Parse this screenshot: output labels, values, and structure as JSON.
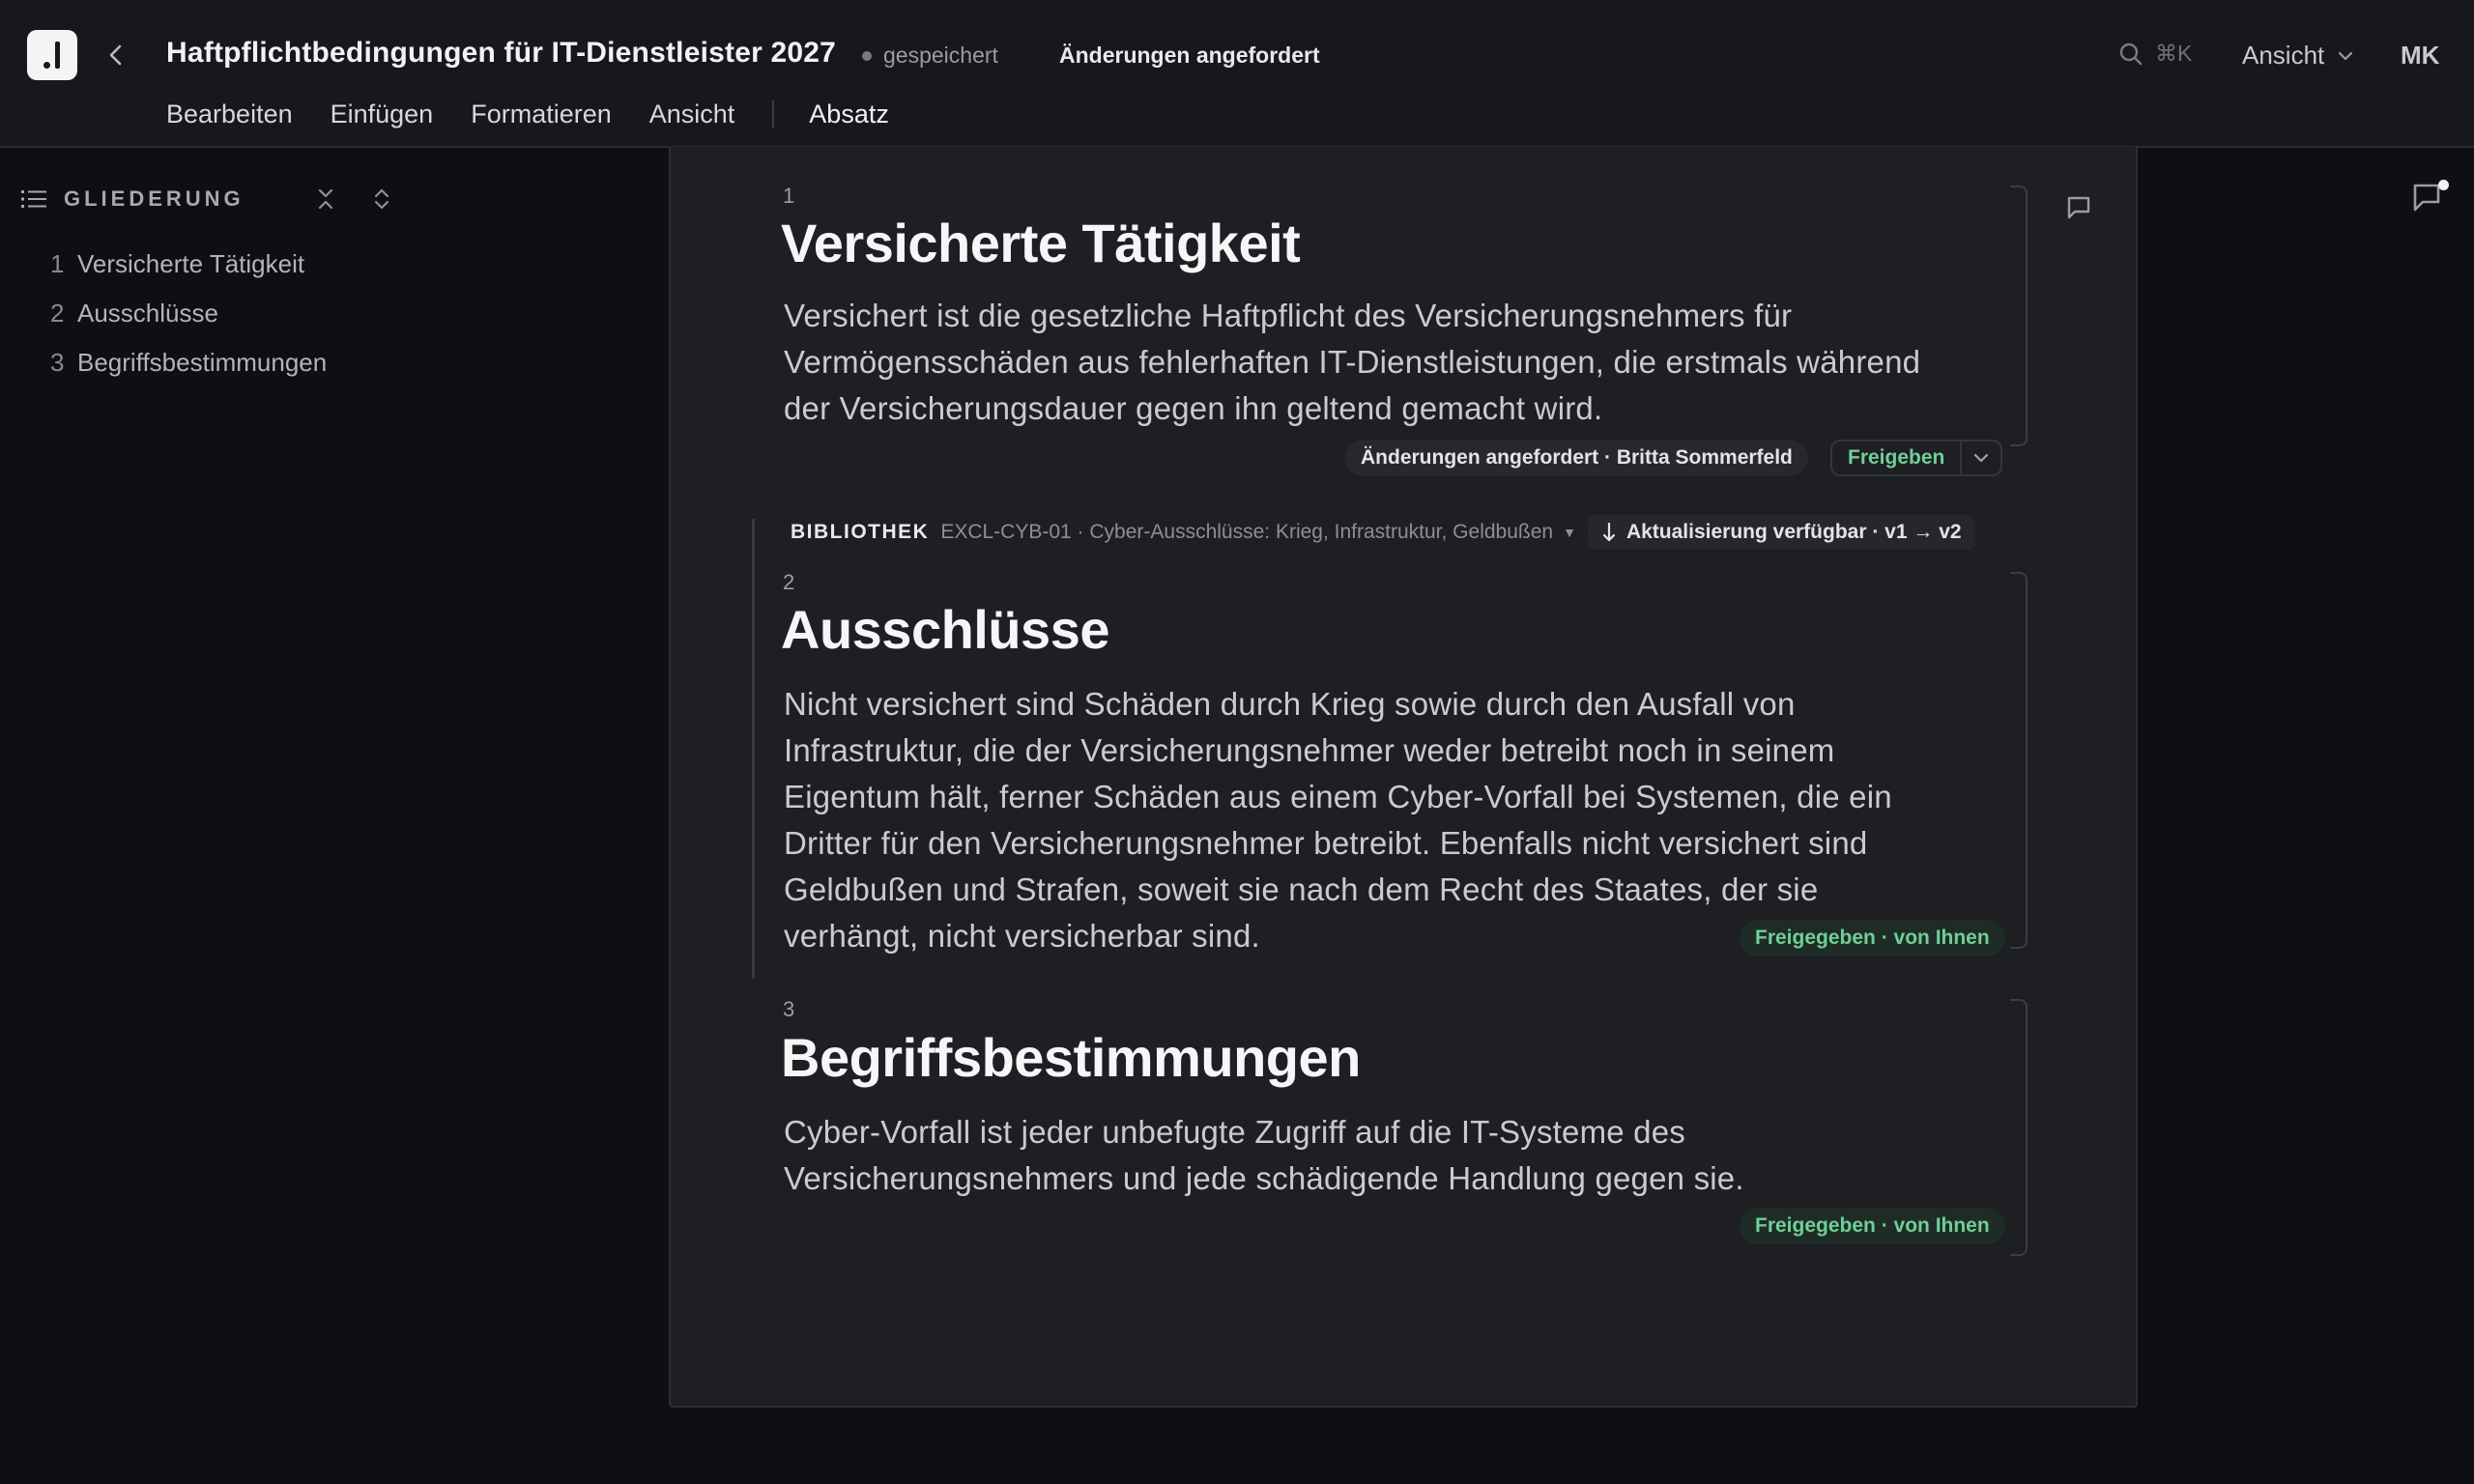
{
  "header": {
    "doc_title": "Haftpflichtbedingungen für IT-Dienstleister 2027",
    "save_status": "gespeichert",
    "review_status": "Änderungen angefordert",
    "search_shortcut": "⌘K",
    "view_label": "Ansicht",
    "user_initials": "MK"
  },
  "menu": {
    "items": [
      "Bearbeiten",
      "Einfügen",
      "Formatieren",
      "Ansicht"
    ],
    "style_label": "Absatz"
  },
  "outline": {
    "title": "GLIEDERUNG",
    "items": [
      {
        "num": "1",
        "label": "Versicherte Tätigkeit"
      },
      {
        "num": "2",
        "label": "Ausschlüsse"
      },
      {
        "num": "3",
        "label": "Begriffsbestimmungen"
      }
    ]
  },
  "sections": [
    {
      "num": "1",
      "title": "Versicherte Tätigkeit",
      "body": "Versichert ist die gesetzliche Haftpflicht des Versicherungsnehmers für Vermögensschäden aus fehlerhaften IT-Dienstleistungen, die erstmals während der Versicherungsdauer gegen ihn geltend gemacht wird.",
      "status": "Änderungen angefordert · Britta Sommerfeld",
      "action": "Freigeben"
    },
    {
      "num": "2",
      "title": "Ausschlüsse",
      "body": "Nicht versichert sind Schäden durch Krieg sowie durch den Ausfall von Infrastruktur, die der Versicherungsnehmer weder betreibt noch in seinem Eigentum hält, ferner Schäden aus einem Cyber-Vorfall bei Systemen, die ein Dritter für den Versicherungsnehmer betreibt. Ebenfalls nicht versichert sind Geldbußen und Strafen, soweit sie nach dem Recht des Staates, der sie verhängt, nicht versicherbar sind.",
      "status": "Freigegeben · von Ihnen"
    },
    {
      "num": "3",
      "title": "Begriffsbestimmungen",
      "body": "Cyber-Vorfall ist jeder unbefugte Zugriff auf die IT-Systeme des Versicherungsnehmers und jede schädigende Handlung gegen sie.",
      "status": "Freigegeben · von Ihnen"
    }
  ],
  "library": {
    "tag": "BIBLIOTHEK",
    "reference": "EXCL-CYB-01 · Cyber-Ausschlüsse: Krieg, Infrastruktur, Geldbußen",
    "update": "Aktualisierung verfügbar · v1 → v2"
  },
  "colors": {
    "background": "#0e0f12",
    "page": "#1d1f23",
    "approved_green": "#6fcf97"
  }
}
